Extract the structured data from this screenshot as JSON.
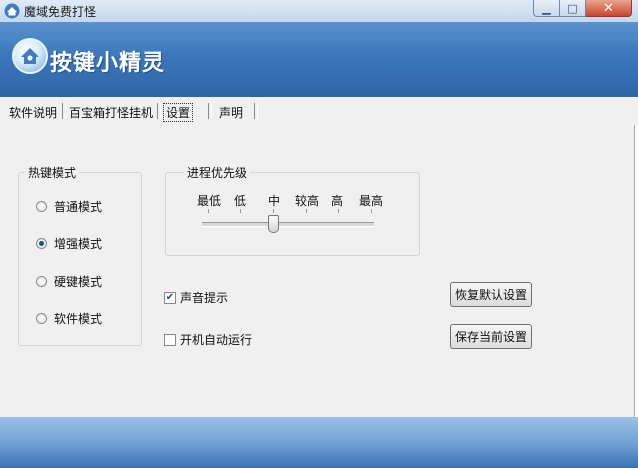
{
  "window": {
    "title": "魔域免费打怪"
  },
  "banner": {
    "logo_text": "按键小精灵"
  },
  "tabs": [
    {
      "label": "软件说明",
      "active": false
    },
    {
      "label": "百宝箱打怪挂机",
      "active": false
    },
    {
      "label": "设置",
      "active": true
    },
    {
      "label": "声明",
      "active": false
    }
  ],
  "hotkey_mode": {
    "title": "热键模式",
    "options": [
      {
        "label": "普通模式",
        "selected": false
      },
      {
        "label": "增强模式",
        "selected": true
      },
      {
        "label": "硬键模式",
        "selected": false
      },
      {
        "label": "软件模式",
        "selected": false
      }
    ]
  },
  "process_priority": {
    "title": "进程优先级",
    "levels": [
      "最低",
      "低",
      "中",
      "较高",
      "高",
      "最高"
    ],
    "selected": "中"
  },
  "checkboxes": {
    "sound": {
      "label": "声音提示",
      "checked": true
    },
    "autostart": {
      "label": "开机自动运行",
      "checked": false
    }
  },
  "buttons": {
    "restore_default": "恢复默认设置",
    "save_current": "保存当前设置"
  },
  "icons": {
    "app": "house-icon",
    "minimize": "minimize-icon",
    "maximize": "maximize-icon",
    "close": "close-icon",
    "logo": "house-logo-icon"
  },
  "colors": {
    "banner": "#3b77ba",
    "close_button": "#c9462c"
  }
}
